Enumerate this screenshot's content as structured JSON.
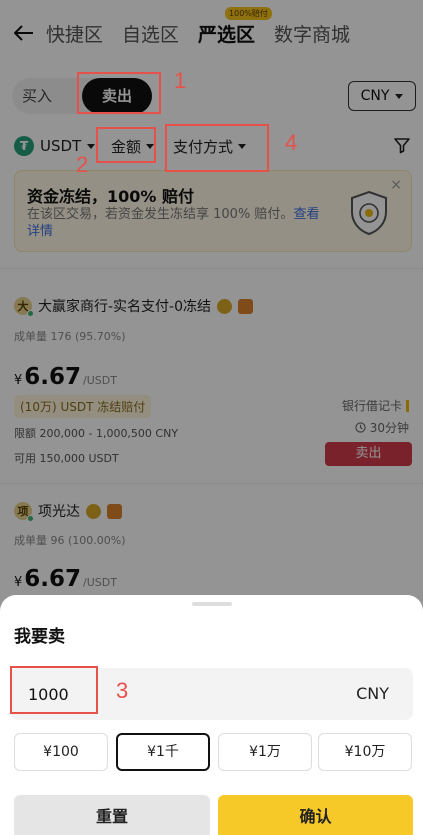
{
  "nav": {
    "tabs": [
      {
        "label": "快捷区"
      },
      {
        "label": "自选区"
      },
      {
        "label": "严选区",
        "badge": "100%赔付"
      },
      {
        "label": "数字商城"
      }
    ]
  },
  "trade": {
    "buy_label": "买入",
    "sell_label": "卖出",
    "currency": "CNY"
  },
  "filters": {
    "asset": "USDT",
    "amount": "金额",
    "payment": "支付方式"
  },
  "notice": {
    "title": "资金冻结，100% 赔付",
    "desc": "在该区交易，若资金发生冻结享 100% 赔付。",
    "link": "查看详情",
    "close": "×"
  },
  "offers": [
    {
      "avatar": "大",
      "name": "大赢家商行-实名支付-0冻结",
      "stats": "成单量 176 (95.70%)",
      "currency_symbol": "¥",
      "price": "6.67",
      "unit": "/USDT",
      "freeze": "(10万) USDT 冻结赔付",
      "limit": "限额 200,000 - 1,000,500 CNY",
      "available": "可用 150,000 USDT",
      "payment": "银行借记卡",
      "time": "30分钟",
      "action": "卖出"
    },
    {
      "avatar": "项",
      "name": "项光达",
      "stats": "成单量 96 (100.00%)",
      "currency_symbol": "¥",
      "price": "6.67",
      "unit": "/USDT"
    }
  ],
  "sheet": {
    "title": "我要卖",
    "amount_value": "1000",
    "currency": "CNY",
    "quick": [
      {
        "label": "¥100"
      },
      {
        "label": "¥1千"
      },
      {
        "label": "¥1万"
      },
      {
        "label": "¥10万"
      }
    ],
    "reset": "重置",
    "confirm": "确认"
  },
  "annotations": {
    "n1": "1",
    "n2": "2",
    "n3": "3",
    "n4": "4",
    "color": "#e8504a"
  }
}
